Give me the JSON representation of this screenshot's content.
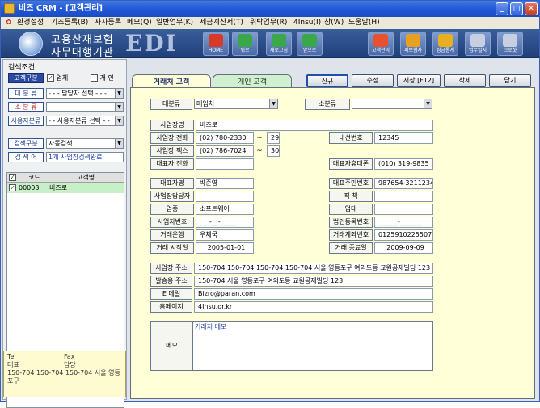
{
  "window": {
    "title": "비즈 CRM - [고객관리]"
  },
  "menu": [
    "환경설정",
    "기초등록(B)",
    "자사등록",
    "메모(Q)",
    "일반업무(K)",
    "세금계산서(T)",
    "위탁업무(R)",
    "4Insu(I)",
    "창(W)",
    "도움말(H)"
  ],
  "banner": {
    "line1": "고용산재보험",
    "line2": "사무대행기관",
    "edi": "EDI",
    "buttons": [
      "HOME",
      "뒤로",
      "새로고침",
      "앞으로",
      "고객관리",
      "피보험자",
      "징금통계",
      "업무일지",
      "크로샷"
    ]
  },
  "search": {
    "group_title": "검색조건",
    "type_label": "고객구분",
    "check_company": "업체",
    "check_personal": "개 인",
    "cat_large_label": "대 분 류",
    "cat_large_value": "- - - 담당자 선택 - - -",
    "cat_small_label": "소 분 류",
    "cat_small_value": "",
    "user_cat_label": "사용자분류",
    "user_cat_value": "- - 사용자분류 선택 - -",
    "search_type_label": "검색구분",
    "search_type_value": "자동검색",
    "search_word_label": "검 색 어",
    "search_result": "1개 사업장검색완료"
  },
  "list": {
    "headers": [
      "코드",
      "고객명"
    ],
    "rows": [
      {
        "code": "00003",
        "name": "비즈로"
      }
    ]
  },
  "info": {
    "line1": "Tel",
    "line1b": "Fax",
    "line2": "대표",
    "line2b": "담당",
    "line3": "150-704 150-704 150-704 서울 영등포구"
  },
  "tabs": {
    "company": "거래처 고객",
    "personal": "개인 고객"
  },
  "actions": {
    "new": "신규",
    "edit": "수정",
    "save": "저장 [F12]",
    "delete": "삭제",
    "close": "닫기"
  },
  "form": {
    "cat_large_label": "대분류",
    "cat_large_value": "매입처",
    "cat_small_label": "소분류",
    "cat_small_value": "",
    "biz_name_label": "사업장명",
    "biz_name": "비즈로",
    "biz_tel_label": "사업장 전화",
    "biz_tel": "(02) 780-2330",
    "biz_tel_ext": "29",
    "ext_label": "내선번호",
    "ext": "12345",
    "biz_fax_label": "사업장 팩스",
    "biz_fax": "(02) 786-7024",
    "biz_fax_ext": "30",
    "rep_tel_label": "대표자 전화",
    "rep_tel": "",
    "rep_mobile_label": "대표자휴대폰",
    "rep_mobile": "(010) 319-9835",
    "rep_name_label": "대표자명",
    "rep_name": "박준영",
    "resident_label": "대표주민번호",
    "resident": "987654-3211234",
    "contact_label": "사업장담당자",
    "contact": "",
    "position_label": "직 책",
    "position": "",
    "bizcat_label": "업종",
    "bizcat": "소프트웨어",
    "biztype_label": "업태",
    "biztype": "",
    "regno_label": "사업자번호",
    "regno": "___-__-_____",
    "corpno_label": "법인등록번호",
    "corpno": "______-_______",
    "bank_label": "거래은행",
    "bank": "우체국",
    "account_label": "거래계좌번호",
    "account": "01259102255071",
    "start_label": "거래 시작일",
    "start": "2005-01-01",
    "end_label": "거래 종료일",
    "end": "2009-09-09",
    "addr_label": "사업장 주소",
    "addr": "150-704 150-704 150-704 150-704 서울 영등포구 여의도동 교원공제빌딩 123",
    "ship_label": "발송용 주소",
    "ship": "150-704 서울 영등포구 여의도동 교원공제빌딩 123",
    "email_label": "E 메일",
    "email": "Bizro@paran.com",
    "homepage_label": "홈페이지",
    "homepage": "4Insu.or.kr",
    "memo_label": "메모",
    "memo": "거래처 메모",
    "tilde": "~"
  }
}
